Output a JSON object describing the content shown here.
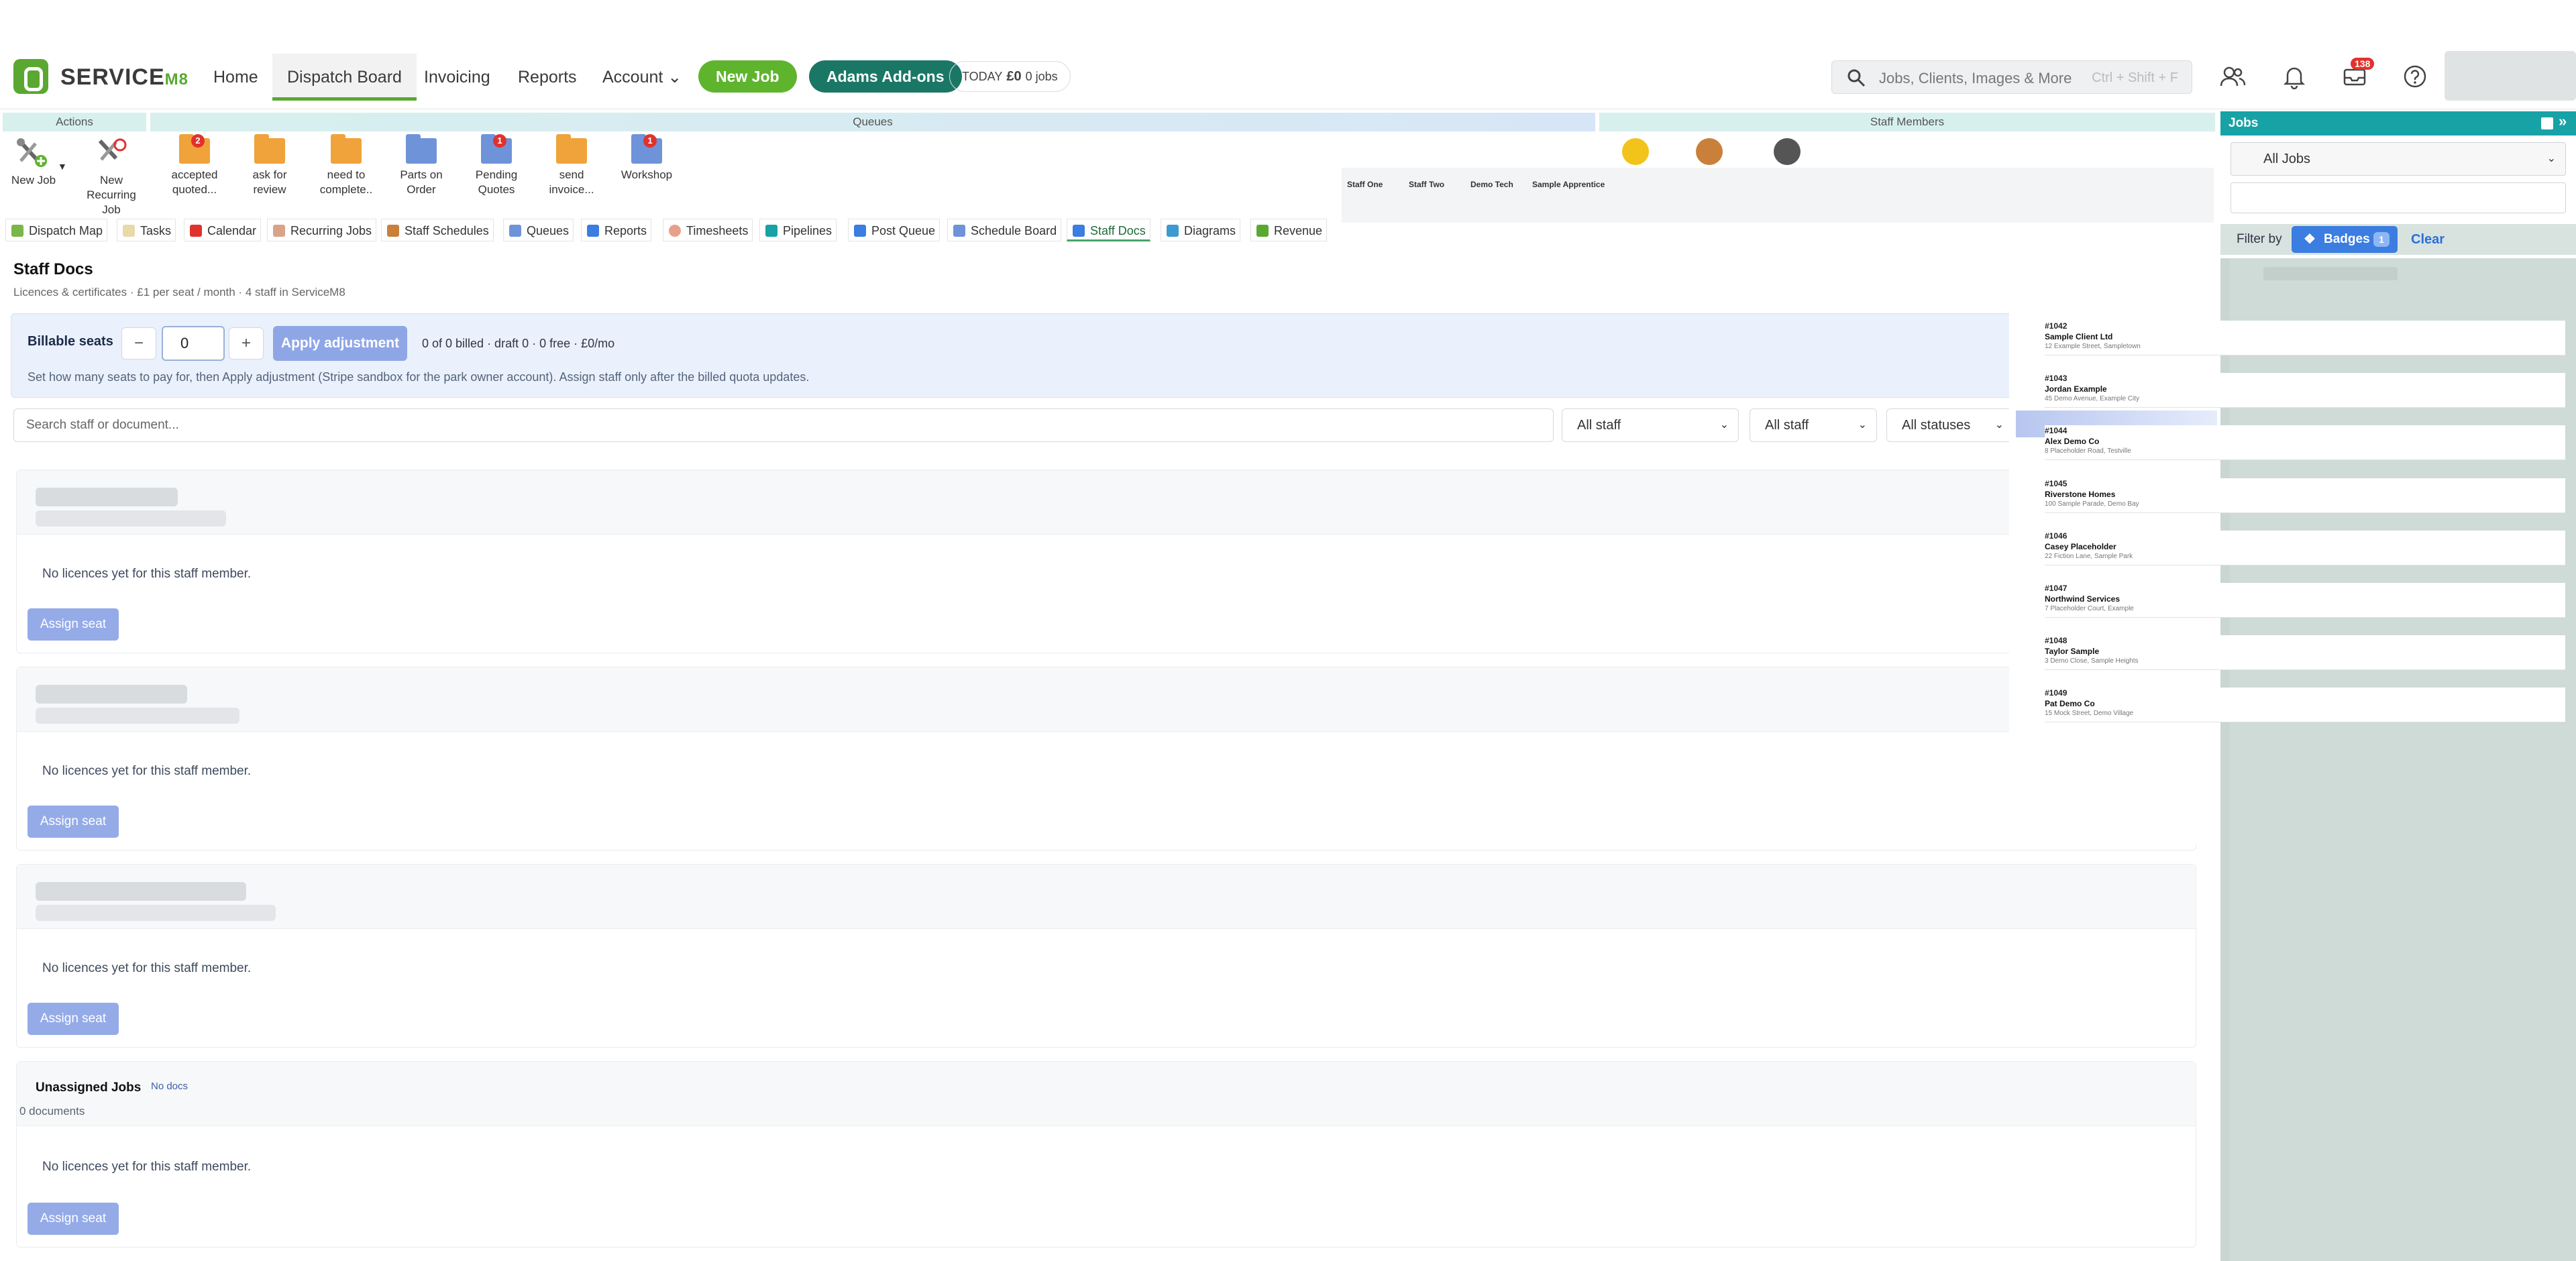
{
  "brand": {
    "name": "SERVICE",
    "suffix": "M8",
    "accent": "#5aa832"
  },
  "nav": {
    "home": "Home",
    "dispatch": "Dispatch Board",
    "invoicing": "Invoicing",
    "reports": "Reports",
    "account": "Account",
    "new_job": "New Job",
    "addons": "Adams Add-ons",
    "today_label": "TODAY",
    "today_amount": "£0",
    "today_jobs": "0 jobs"
  },
  "search": {
    "placeholder": "Jobs, Clients, Images & More",
    "shortcut": "Ctrl + Shift + F"
  },
  "notifications": {
    "inbox_count": "138"
  },
  "panels": {
    "actions": "Actions",
    "queues": "Queues",
    "staff": "Staff Members"
  },
  "actions": [
    {
      "label": "New Job"
    },
    {
      "label": "New Recurring Job"
    }
  ],
  "queues": [
    {
      "label": "accepted quoted...",
      "badge": "2",
      "color": "#f0a33a"
    },
    {
      "label": "ask for review",
      "badge": "",
      "color": "#f0a33a"
    },
    {
      "label": "need to complete..",
      "badge": "",
      "color": "#f0a33a"
    },
    {
      "label": "Parts on Order",
      "badge": "",
      "color": "#6f93d8"
    },
    {
      "label": "Pending Quotes",
      "badge": "1",
      "color": "#6f93d8"
    },
    {
      "label": "send invoice...",
      "badge": "",
      "color": "#f0a33a"
    },
    {
      "label": "Workshop",
      "badge": "1",
      "color": "#6f93d8"
    }
  ],
  "staff_members": [
    "Staff One",
    "Staff Two",
    "Demo Tech",
    "Sample Apprentice"
  ],
  "tabs": [
    "Dispatch Map",
    "Tasks",
    "Calendar",
    "Recurring Jobs",
    "Staff Schedules",
    "Queues",
    "Reports",
    "Timesheets",
    "Pipelines",
    "Post Queue",
    "Schedule Board",
    "Staff Docs",
    "Diagrams",
    "Revenue"
  ],
  "staffdocs": {
    "title": "Staff Docs",
    "subtitle": "Licences & certificates · £1 per seat / month · 4 staff in ServiceM8",
    "seats_label": "Billable seats",
    "minus": "−",
    "plus": "+",
    "seats_value": "0",
    "apply": "Apply adjustment",
    "billed_summary": "0 of 0 billed · draft 0 · 0 free · £0/mo",
    "hint": "Set how many seats to pay for, then Apply adjustment (Stripe sandbox for the park owner account). Assign staff only after the billed quota updates.",
    "search_placeholder": "Search staff or document...",
    "filter1": "All staff",
    "filter2": "All staff",
    "filter3": "All statuses",
    "no_licences": "No licences yet for this staff member.",
    "assign": "Assign seat",
    "unassigned_title": "Unassigned Jobs",
    "unassigned_badge": "No docs",
    "unassigned_count": "0 documents"
  },
  "jobs_panel": {
    "title": "Jobs",
    "select": "All Jobs",
    "filter_by": "Filter by",
    "badges": "Badges",
    "badges_count": "1",
    "clear": "Clear"
  },
  "jobs": [
    {
      "num": "#1042",
      "client": "Sample Client Ltd",
      "address": "12 Example Street, Sampletown"
    },
    {
      "num": "#1043",
      "client": "Jordan Example",
      "address": "45 Demo Avenue, Example City"
    },
    {
      "num": "#1044",
      "client": "Alex Demo Co",
      "address": "8 Placeholder Road, Testville"
    },
    {
      "num": "#1045",
      "client": "Riverstone Homes",
      "address": "100 Sample Parade, Demo Bay"
    },
    {
      "num": "#1046",
      "client": "Casey Placeholder",
      "address": "22 Fiction Lane, Sample Park"
    },
    {
      "num": "#1047",
      "client": "Northwind Services",
      "address": "7 Placeholder Court, Example"
    },
    {
      "num": "#1048",
      "client": "Taylor Sample",
      "address": "3 Demo Close, Sample Heights"
    },
    {
      "num": "#1049",
      "client": "Pat Demo Co",
      "address": "15 Mock Street, Demo Village"
    }
  ]
}
